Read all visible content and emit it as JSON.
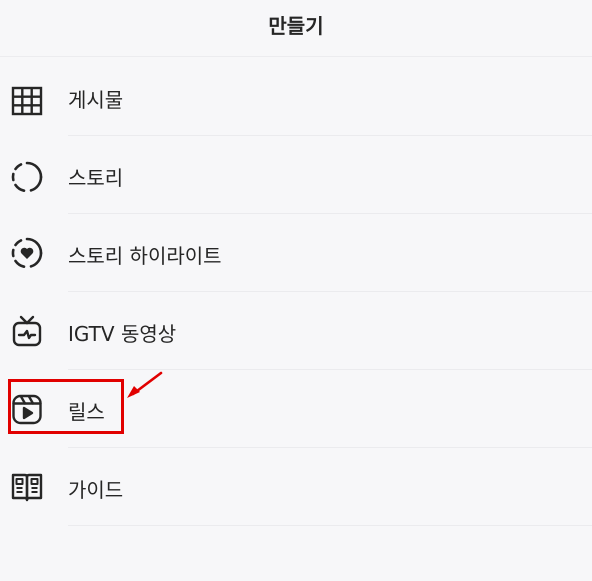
{
  "header": {
    "title": "만들기"
  },
  "menu": {
    "items": [
      {
        "label": "게시물",
        "icon": "grid-icon"
      },
      {
        "label": "스토리",
        "icon": "story-ring-icon"
      },
      {
        "label": "스토리 하이라이트",
        "icon": "highlight-heart-icon"
      },
      {
        "label": "IGTV 동영상",
        "icon": "igtv-icon"
      },
      {
        "label": "릴스",
        "icon": "reels-icon"
      },
      {
        "label": "가이드",
        "icon": "guide-book-icon"
      }
    ]
  },
  "annotation": {
    "highlight_color": "#e10000",
    "highlighted_item": "릴스"
  },
  "colors": {
    "background": "#f7f7f9",
    "text": "#262626",
    "divider": "#ebebee"
  }
}
